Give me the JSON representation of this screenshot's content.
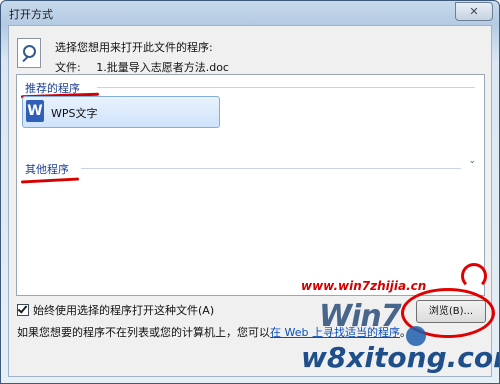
{
  "window": {
    "title": "打开方式",
    "close_glyph": "✕"
  },
  "dialog": {
    "prompt": "选择您想用来打开此文件的程序:",
    "file_label": "文件:",
    "file_name": "1.批量导入志愿者方法.doc"
  },
  "listbox": {
    "recommended_header": "推荐的程序",
    "recommended_items": [
      {
        "label": "WPS文字",
        "icon": "wps-writer-icon",
        "icon_glyph": "W"
      }
    ],
    "other_header": "其他程序",
    "expand_glyph": "⌄"
  },
  "always_use": {
    "label": "始终使用选择的程序打开这种文件(A)",
    "checked": true
  },
  "browse_button": "浏览(B)...",
  "hint": {
    "text": "如果您想要的程序不在列表或您的计算机上，您可以",
    "link": "在 Web 上寻找适当的程序",
    "suffix": "。"
  },
  "watermarks": {
    "site": "www.win7zhijia.cn",
    "brand": "Win7",
    "domain": "w8xitong.com"
  },
  "colors": {
    "annotation_red": "#e00000",
    "link_blue": "#0b4fb5",
    "header_blue": "#1b3f94"
  }
}
